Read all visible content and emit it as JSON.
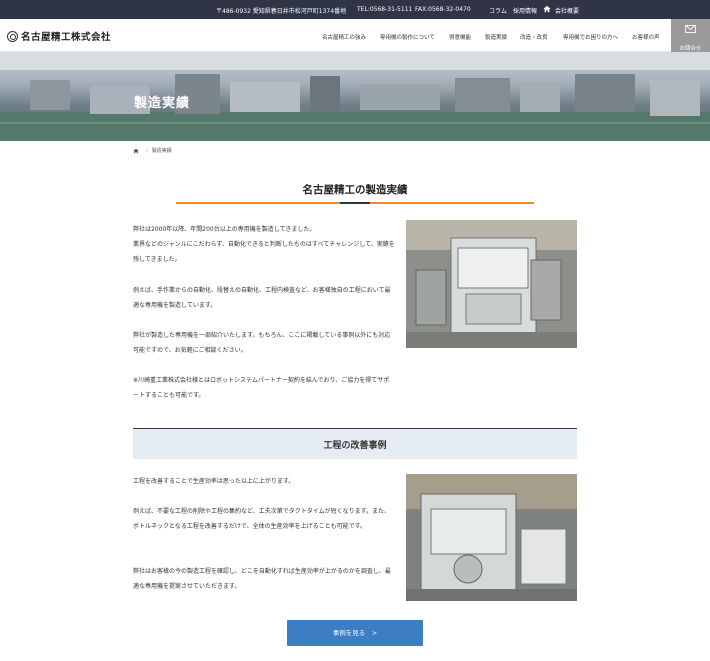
{
  "topbar": {
    "address": "〒486-0932 愛知県春日井市松河戸町1374番地",
    "tel": "TEL:0568-31-5111",
    "fax": "FAX:0568-32-0470",
    "column": "コラム",
    "recruit": "採用情報",
    "company": "会社概要"
  },
  "header": {
    "logo_text": "名古屋精工株式会社",
    "nav": [
      "名古屋精工の強み",
      "専用機の製作について",
      "得意機能",
      "製造実績",
      "改造・改良",
      "専用機でお困りの方へ",
      "お客様の声"
    ],
    "contact_label": "お問合せ"
  },
  "hero": {
    "title": "製造実績"
  },
  "breadcrumb": {
    "current": "製造実績"
  },
  "main": {
    "title": "名古屋精工の製造実績",
    "intro_paragraphs": [
      "弊社は2000年以降、年間200台以上の専用機を製造してきました。\n業界などのジャンルにこだわらず、自動化できると判断したものはすべてチャレンジして、実績を残してきました。",
      "例えば、手作業からの自動化、段替えの自動化、工程内検査など、お客様独自の工程において最適な専用機を製造しています。",
      "弊社が製造した専用機を一部紹介いたします。もちろん、ここに掲載している事例以外にも対応可能ですので、お気軽にご相談ください。",
      "※川崎重工業株式会社様とはロボットシステムパートナー契約を結んでおり、ご協力を得てサポートすることも可能です。"
    ]
  },
  "improvement": {
    "title": "工程の改善事例",
    "paragraphs": [
      "工程を改善することで生産効率は思った以上に上がります。",
      "例えば、不要な工程の削除や工程の集約など、工夫次第でタクトタイムが短くなります。また、ボトルネックとなる工程を改善するだけで、全体の生産効率を上げることも可能です。",
      "弊社はお客様の今の製造工程を確認し、どこを自動化すれば生産効率が上がるのかを調査し、最適な専用機を提案させていただきます。"
    ],
    "cta_label": "事例を見る　>"
  },
  "colors": {
    "topbar": "#2f3447",
    "accent": "#f08a2c",
    "cta": "#3c7dc4",
    "subhead_bg": "#e6ecf3"
  },
  "icons": [
    "logo-mark-icon",
    "home-icon",
    "envelope-icon",
    "breadcrumb-home-icon"
  ]
}
